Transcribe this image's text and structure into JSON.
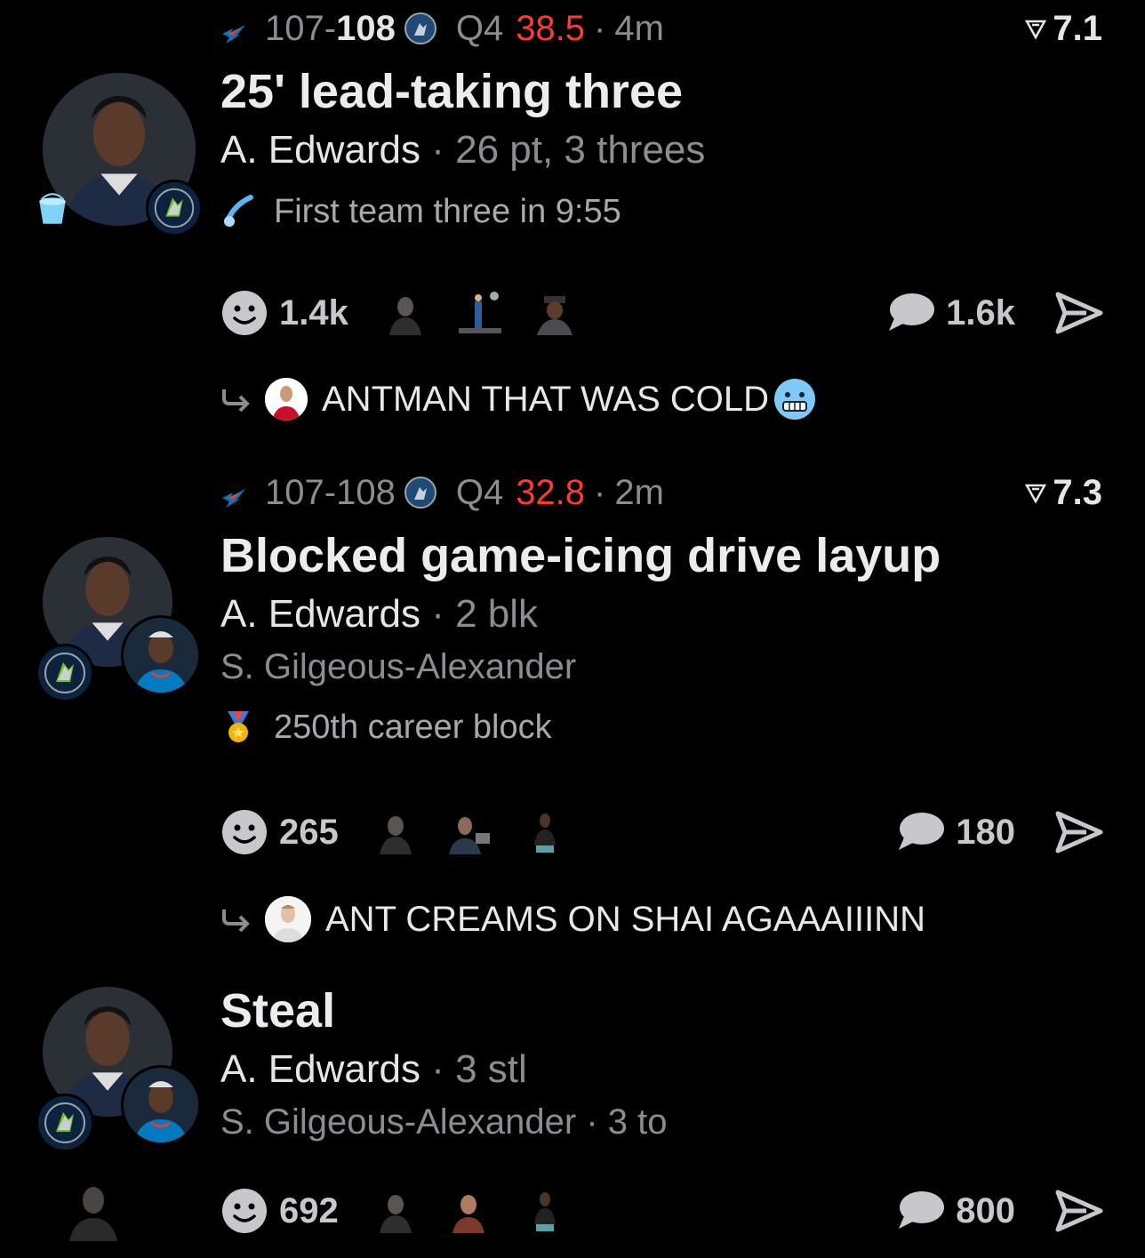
{
  "feed": {
    "items": [
      {
        "score_home": "107",
        "score_away": "108",
        "quarter": "Q4",
        "clock": "38.5",
        "ago": "4m",
        "rating": "7.1",
        "title": "25' lead-taking three",
        "player": "A. Edwards",
        "player_stat": "26 pt, 3 threes",
        "note": "First team three in 9:55",
        "note_icon": "comet-icon",
        "reactions": "1.4k",
        "comments": "1.6k",
        "reply_text": "ANTMAN THAT WAS COLD",
        "reply_emoji": "freezing-face-icon"
      },
      {
        "score_home": "107",
        "score_away": "108",
        "quarter": "Q4",
        "clock": "32.8",
        "ago": "2m",
        "rating": "7.3",
        "title": "Blocked game-icing drive layup",
        "player": "A. Edwards",
        "player_stat": "2 blk",
        "opponent": "S. Gilgeous-Alexander",
        "note": "250th career block",
        "note_icon": "medal-icon",
        "reactions": "265",
        "comments": "180",
        "reply_text": "ANT CREAMS ON SHAI AGAAAIIINN"
      },
      {
        "title": "Steal",
        "player": "A. Edwards",
        "player_stat": "3 stl",
        "opponent": "S. Gilgeous-Alexander",
        "opponent_stat": "3 to",
        "reactions": "692",
        "comments": "800"
      }
    ]
  },
  "separator": "·",
  "colors": {
    "background": "#000000",
    "clock_red": "#ff3b30",
    "muted": "#8c8c91",
    "wolves_navy": "#0c2340",
    "thunder_blue": "#007ac1"
  }
}
